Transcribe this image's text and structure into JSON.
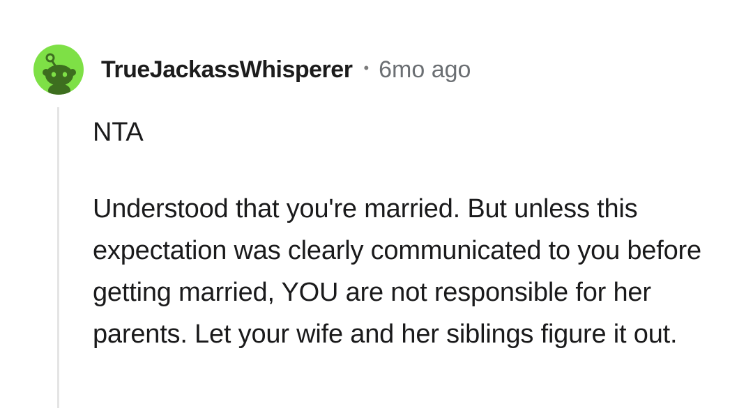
{
  "comment": {
    "avatar_icon": "reddit-snoo-avatar-icon",
    "avatar_color": "#7ee046",
    "username": "TrueJackassWhisperer",
    "separator": "•",
    "timestamp": "6mo ago",
    "body": {
      "paragraph_1": "NTA",
      "paragraph_2": "Understood that you're married. But unless this expectation was clearly communicated to you before getting married, YOU are not responsible for her parents. Let your wife and her siblings figure it out."
    }
  }
}
